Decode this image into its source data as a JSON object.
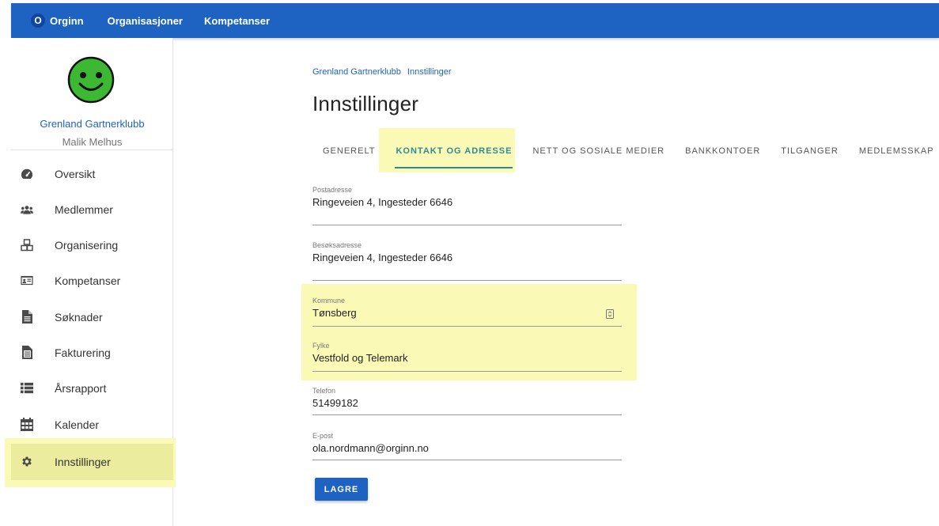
{
  "topbar": {
    "brand_badge": "O",
    "brand_name": "Orginn",
    "nav": [
      "Organisasjoner",
      "Kompetanser"
    ]
  },
  "sidebar": {
    "org_name": "Grenland Gartnerklubb",
    "user_name": "Malik Melhus",
    "items": [
      {
        "label": "Oversikt",
        "icon": "speedometer-icon"
      },
      {
        "label": "Medlemmer",
        "icon": "people-icon"
      },
      {
        "label": "Organisering",
        "icon": "cubes-icon"
      },
      {
        "label": "Kompetanser",
        "icon": "id-card-icon"
      },
      {
        "label": "Søknader",
        "icon": "document-icon"
      },
      {
        "label": "Fakturering",
        "icon": "invoice-icon"
      },
      {
        "label": "Årsrapport",
        "icon": "list-icon"
      },
      {
        "label": "Kalender",
        "icon": "calendar-icon"
      },
      {
        "label": "Innstillinger",
        "icon": "gear-icon",
        "active": true
      }
    ]
  },
  "main": {
    "breadcrumb": [
      "Grenland Gartnerklubb",
      "Innstillinger"
    ],
    "title": "Innstillinger",
    "tabs": [
      "GENERELT",
      "KONTAKT OG ADRESSE",
      "NETT OG SOSIALE MEDIER",
      "BANKKONTOER",
      "TILGANGER",
      "MEDLEMSSKAP"
    ],
    "active_tab": "KONTAKT OG ADRESSE",
    "fields": {
      "postadresse": {
        "label": "Postadresse",
        "value": "Ringeveien 4, Ingesteder 6646"
      },
      "besoksadresse": {
        "label": "Besøksadresse",
        "value": "Ringeveien 4, Ingesteder 6646"
      },
      "kommune": {
        "label": "Kommune",
        "value": "Tønsberg"
      },
      "fylke": {
        "label": "Fylke",
        "value": "Vestfold og Telemark"
      },
      "telefon": {
        "label": "Telefon",
        "value": "51499182"
      },
      "epost": {
        "label": "E-post",
        "value": "ola.nordmann@orginn.no"
      }
    },
    "save_label": "LAGRE"
  },
  "colors": {
    "primary": "#1e63c2",
    "tab_active": "#2c8c94",
    "highlight": "#fbf9b6",
    "avatar_green": "#3cb832"
  }
}
